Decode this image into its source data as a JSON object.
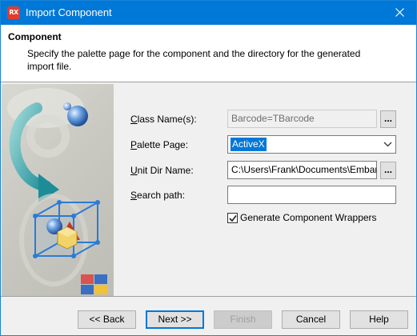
{
  "window": {
    "title": "Import Component",
    "app_icon_text": "RX"
  },
  "header": {
    "title": "Component",
    "description": "Specify the palette page for the component and the directory for the generated import file."
  },
  "form": {
    "class_names": {
      "label_prefix": "C",
      "label_rest": "lass Name(s):",
      "value": "Barcode=TBarcode",
      "browse_label": "..."
    },
    "palette_page": {
      "label_prefix": "P",
      "label_rest": "alette Page:",
      "value": "ActiveX"
    },
    "unit_dir": {
      "label_prefix": "U",
      "label_rest": "nit Dir Name:",
      "value": "C:\\Users\\Frank\\Documents\\Embar",
      "browse_label": "..."
    },
    "search_path": {
      "label_prefix": "S",
      "label_rest": "earch path:",
      "value": ""
    },
    "generate_wrappers": {
      "label": "Generate Component Wrappers",
      "checked": true
    }
  },
  "buttons": {
    "back": "<< Back",
    "next": "Next >>",
    "finish": "Finish",
    "cancel": "Cancel",
    "help": "Help"
  },
  "colors": {
    "titlebar": "#0078d7",
    "selection": "#0078d7",
    "app_icon": "#e23c2c"
  }
}
